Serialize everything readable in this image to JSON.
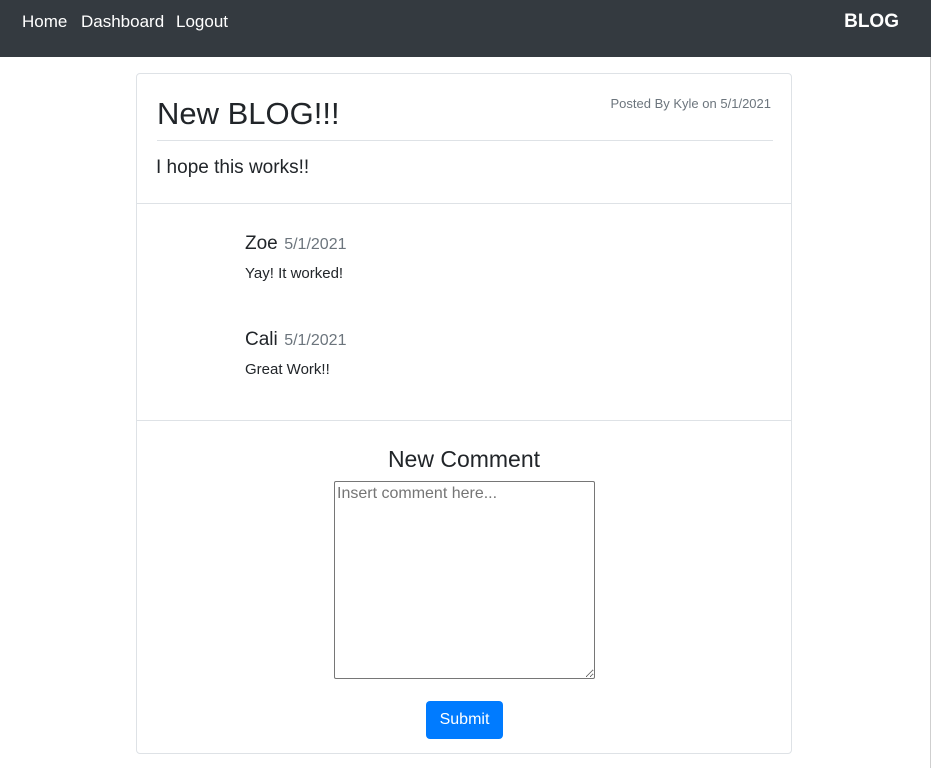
{
  "nav": {
    "links": [
      "Home",
      "Dashboard",
      "Logout"
    ],
    "brand": "BLOG"
  },
  "post": {
    "title": "New BLOG!!!",
    "meta_prefix": "Posted By",
    "author": "Kyle",
    "meta_on": "on",
    "date": "5/1/2021",
    "body": "I hope this works!!"
  },
  "comments": [
    {
      "author": "Zoe",
      "date": "5/1/2021",
      "text": "Yay! It worked!"
    },
    {
      "author": "Cali",
      "date": "5/1/2021",
      "text": "Great Work!!"
    }
  ],
  "new_comment": {
    "heading": "New Comment",
    "placeholder": "Insert comment here...",
    "value": "",
    "submit_label": "Submit"
  },
  "colors": {
    "navbar": "#343a40",
    "primary": "#007bff",
    "muted": "#6c757d",
    "border": "#dee2e6"
  }
}
